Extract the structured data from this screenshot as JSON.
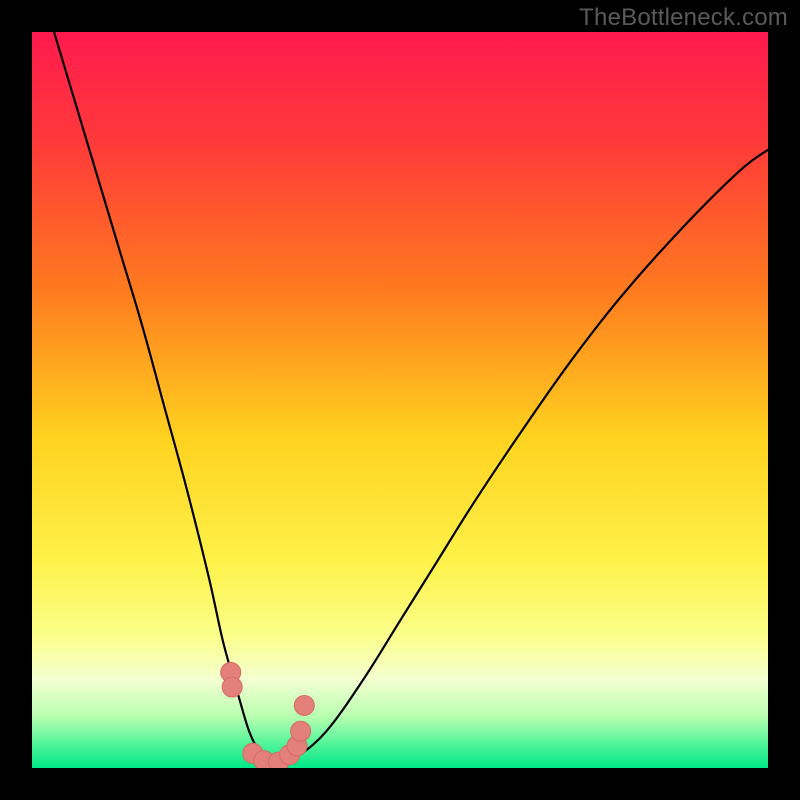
{
  "watermark": "TheBottleneck.com",
  "colors": {
    "background_stops": [
      {
        "offset": 0.0,
        "color": "#ff1a4e"
      },
      {
        "offset": 0.15,
        "color": "#ff3a3a"
      },
      {
        "offset": 0.35,
        "color": "#ff7a1f"
      },
      {
        "offset": 0.55,
        "color": "#ffd21f"
      },
      {
        "offset": 0.72,
        "color": "#fff24a"
      },
      {
        "offset": 0.82,
        "color": "#fbff8a"
      },
      {
        "offset": 0.88,
        "color": "#f3ffd0"
      },
      {
        "offset": 0.93,
        "color": "#b8ffb0"
      },
      {
        "offset": 0.965,
        "color": "#58f59a"
      },
      {
        "offset": 1.0,
        "color": "#00e888"
      }
    ],
    "curve": "#000000",
    "marker_fill": "#e28079",
    "marker_stroke": "#d66b63"
  },
  "chart_data": {
    "type": "line",
    "title": "",
    "xlabel": "",
    "ylabel": "",
    "xlim": [
      0,
      100
    ],
    "ylim": [
      0,
      100
    ],
    "grid": false,
    "legend": false,
    "series": [
      {
        "name": "bottleneck_curve",
        "x": [
          3,
          6,
          9,
          12,
          15,
          18,
          21,
          24,
          26,
          28,
          29.5,
          31,
          32.5,
          34,
          36,
          40,
          45,
          50,
          55,
          60,
          66,
          73,
          80,
          88,
          96,
          100
        ],
        "y": [
          100,
          90,
          80,
          70,
          60,
          49,
          38,
          26,
          17,
          10,
          5,
          2,
          0.5,
          0.5,
          1.5,
          5,
          12,
          20,
          28,
          36,
          45,
          55,
          64,
          73,
          81,
          84
        ]
      }
    ],
    "markers": {
      "name": "highlight_points",
      "x": [
        27.0,
        27.2,
        30.0,
        31.5,
        33.5,
        35.0,
        36.0,
        36.5,
        37.0
      ],
      "y": [
        13.0,
        11.0,
        2.0,
        1.0,
        0.8,
        1.8,
        3.0,
        5.0,
        8.5
      ],
      "size": 10
    }
  }
}
